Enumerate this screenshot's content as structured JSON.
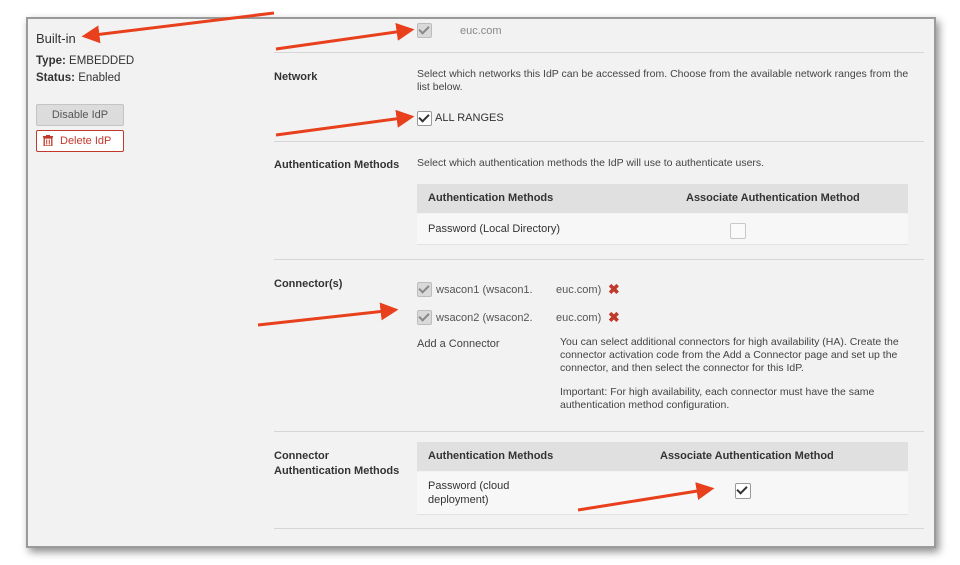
{
  "idp": {
    "title": "Built-in",
    "type_label": "Type:",
    "type_value": "EMBEDDED",
    "status_label": "Status:",
    "status_value": "Enabled",
    "disable_button": "Disable IdP",
    "delete_button": "Delete IdP"
  },
  "users": {
    "domain_text": "euc.com"
  },
  "network": {
    "label": "Network",
    "description": "Select which networks this IdP can be accessed from. Choose from the available network ranges from the list below.",
    "range_label": "ALL RANGES"
  },
  "auth_methods": {
    "label": "Authentication Methods",
    "description": "Select which authentication methods the IdP will use to authenticate users.",
    "col1": "Authentication Methods",
    "col2": "Associate Authentication Method",
    "rows": [
      {
        "name": "Password (Local Directory)",
        "checked": false
      }
    ]
  },
  "connectors": {
    "label": "Connector(s)",
    "items": [
      {
        "name_a": "wsacon1 (wsacon1.",
        "name_b": "euc.com)"
      },
      {
        "name_a": "wsacon2 (wsacon2.",
        "name_b": "euc.com)"
      }
    ],
    "add_link": "Add a Connector",
    "help1": "You can select additional connectors for high availability (HA). Create the connector activation code from the Add a Connector page and set up the connector, and then select the connector for this IdP.",
    "help2": "Important: For high availability, each connector must have the same authentication method configuration."
  },
  "connector_auth": {
    "label": "Connector Authentication Methods",
    "col1": "Authentication Methods",
    "col2": "Associate Authentication Method",
    "rows": [
      {
        "name": "Password (cloud deployment)",
        "checked": true
      }
    ]
  },
  "colors": {
    "arrow": "#e8401c",
    "delete_red": "#c0392b"
  }
}
